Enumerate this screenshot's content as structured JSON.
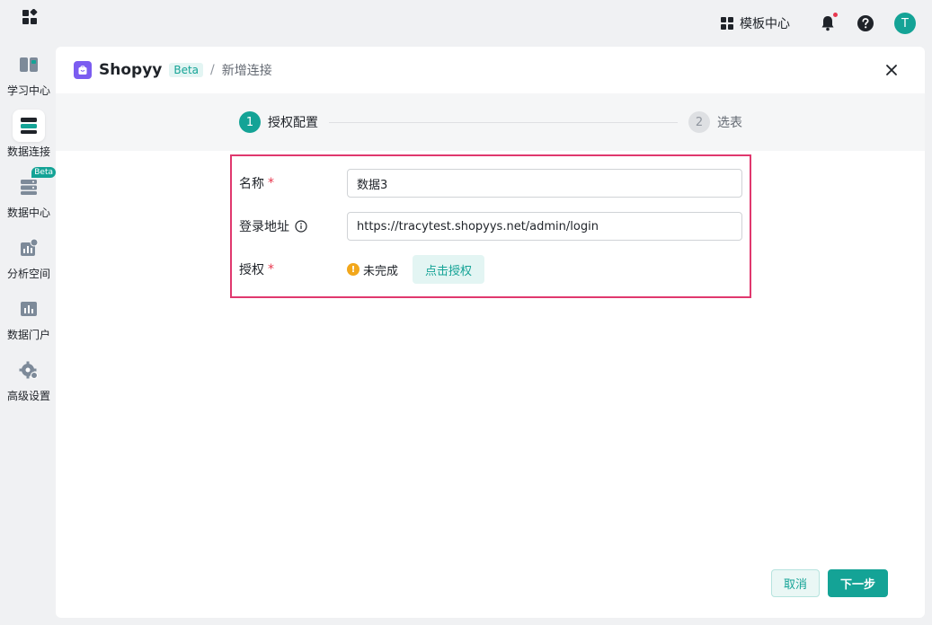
{
  "topbar": {
    "template_center": "模板中心",
    "avatar_initial": "T"
  },
  "sidebar": {
    "items": [
      {
        "label": "学习中心",
        "icon": "book-icon"
      },
      {
        "label": "数据连接",
        "icon": "data-connect-icon",
        "active": true
      },
      {
        "label": "数据中心",
        "icon": "database-icon",
        "badge": "Beta"
      },
      {
        "label": "分析空间",
        "icon": "chart-icon"
      },
      {
        "label": "数据门户",
        "icon": "portal-icon"
      },
      {
        "label": "高级设置",
        "icon": "gear-icon"
      }
    ]
  },
  "header": {
    "brand": "Shopyy",
    "beta": "Beta",
    "separator": "/",
    "crumb": "新增连接"
  },
  "steps": [
    {
      "num": "1",
      "label": "授权配置"
    },
    {
      "num": "2",
      "label": "选表"
    }
  ],
  "form": {
    "name_label": "名称",
    "name_value": "数据3",
    "url_label": "登录地址",
    "url_value": "https://tracytest.shopyys.net/admin/login",
    "auth_label": "授权",
    "required_mark": "*",
    "auth_status": "未完成",
    "auth_button": "点击授权"
  },
  "footer": {
    "cancel": "取消",
    "next": "下一步"
  },
  "colors": {
    "accent": "#14a396",
    "highlight_border": "#e0386e",
    "warning": "#f2a71b",
    "brand_purple": "#7b5cf0"
  }
}
